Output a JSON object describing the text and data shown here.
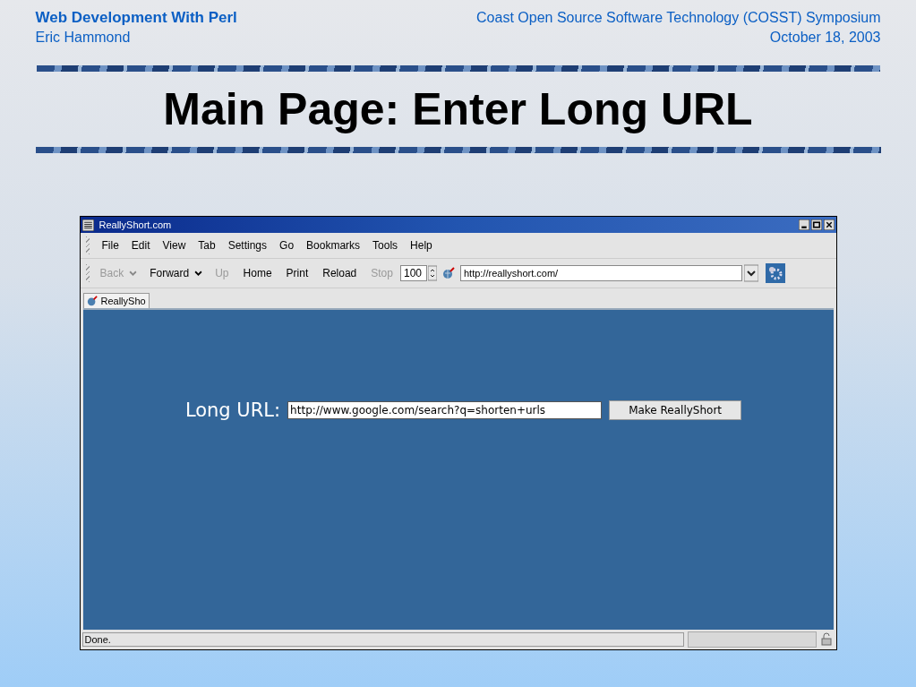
{
  "header": {
    "title": "Web Development With Perl",
    "author": "Eric Hammond",
    "event": "Coast Open Source Software Technology (COSST) Symposium",
    "date": "October 18, 2003"
  },
  "slide_title": "Main Page: Enter Long URL",
  "browser": {
    "title": "ReallyShort.com",
    "menu": [
      "File",
      "Edit",
      "View",
      "Tab",
      "Settings",
      "Go",
      "Bookmarks",
      "Tools",
      "Help"
    ],
    "toolbar": [
      {
        "label": "Back",
        "disabled": true,
        "dropdown": true
      },
      {
        "label": "Forward",
        "disabled": false,
        "dropdown": true
      },
      {
        "label": "Up",
        "disabled": true,
        "dropdown": false
      },
      {
        "label": "Home",
        "disabled": false,
        "dropdown": false
      },
      {
        "label": "Print",
        "disabled": false,
        "dropdown": false
      },
      {
        "label": "Reload",
        "disabled": false,
        "dropdown": false
      },
      {
        "label": "Stop",
        "disabled": true,
        "dropdown": false
      }
    ],
    "zoom": "100",
    "address": "http://reallyshort.com/",
    "tabs": [
      {
        "label": "ReallySho",
        "selected": true
      }
    ],
    "form": {
      "label": "Long URL:",
      "value": "http://www.google.com/search?q=shorten+urls",
      "button": "Make ReallyShort"
    },
    "status": "Done."
  }
}
